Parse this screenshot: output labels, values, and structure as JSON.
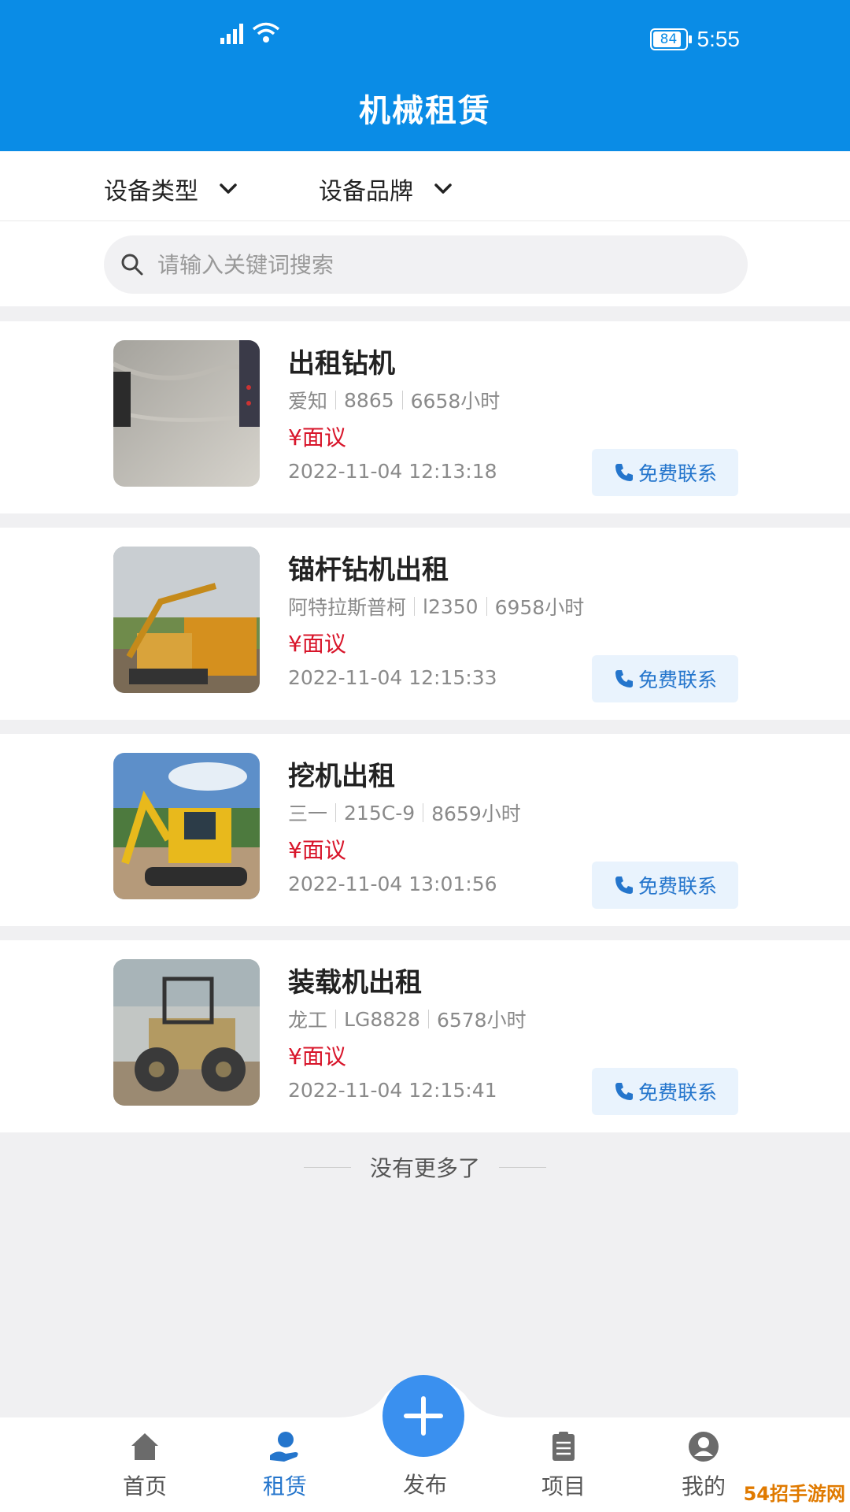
{
  "status": {
    "battery": "84",
    "time": "5:55"
  },
  "header": {
    "title": "机械租赁"
  },
  "filters": {
    "type_label": "设备类型",
    "brand_label": "设备品牌"
  },
  "search": {
    "placeholder": "请输入关键词搜索"
  },
  "listings": [
    {
      "title": "出租钻机",
      "brand": "爱知",
      "model": "8865",
      "hours": "6658小时",
      "price": "¥面议",
      "date": "2022-11-04 12:13:18",
      "contact": "免费联系"
    },
    {
      "title": "锚杆钻机出租",
      "brand": "阿特拉斯普柯",
      "model": "l2350",
      "hours": "6958小时",
      "price": "¥面议",
      "date": "2022-11-04 12:15:33",
      "contact": "免费联系"
    },
    {
      "title": "挖机出租",
      "brand": "三一",
      "model": "215C-9",
      "hours": "8659小时",
      "price": "¥面议",
      "date": "2022-11-04 13:01:56",
      "contact": "免费联系"
    },
    {
      "title": "装载机出租",
      "brand": "龙工",
      "model": "LG8828",
      "hours": "6578小时",
      "price": "¥面议",
      "date": "2022-11-04 12:15:41",
      "contact": "免费联系"
    }
  ],
  "footer": {
    "no_more": "没有更多了"
  },
  "nav": {
    "home": "首页",
    "rent": "租赁",
    "publish": "发布",
    "project": "项目",
    "mine": "我的"
  },
  "watermark": "54招手游网",
  "colors": {
    "primary": "#0a8ce6",
    "accent": "#2475cc",
    "price": "#d8152a"
  }
}
